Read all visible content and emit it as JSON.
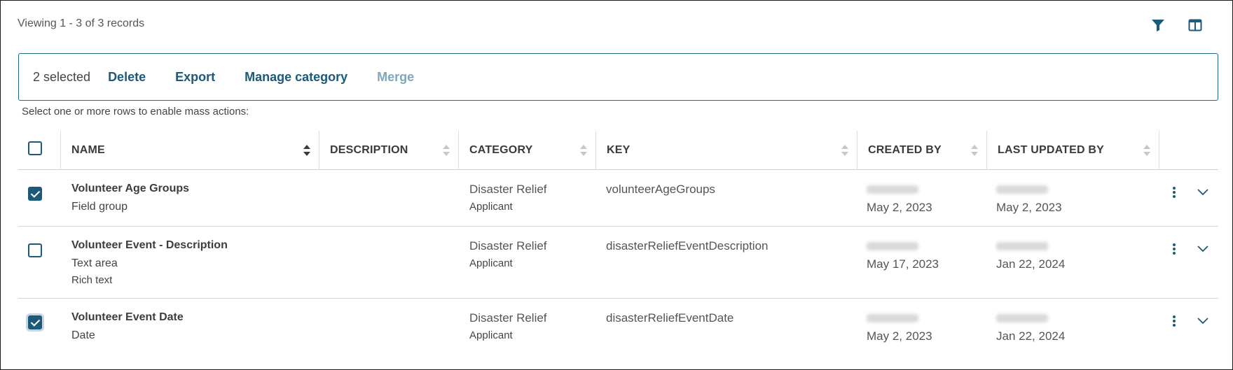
{
  "header": {
    "viewing_text": "Viewing 1 - 3 of 3 records"
  },
  "icons": {
    "filter": "filter-icon",
    "columns": "columns-icon"
  },
  "mass_actions": {
    "selected_text": "2 selected",
    "delete": "Delete",
    "export": "Export",
    "manage_category": "Manage category",
    "merge": "Merge",
    "hint": "Select one or more rows to enable mass actions:"
  },
  "columns": [
    {
      "label": "NAME"
    },
    {
      "label": "DESCRIPTION"
    },
    {
      "label": "CATEGORY"
    },
    {
      "label": "KEY"
    },
    {
      "label": "CREATED BY"
    },
    {
      "label": "LAST UPDATED BY"
    }
  ],
  "rows": [
    {
      "checked": true,
      "name": "Volunteer Age Groups",
      "type": "Field group",
      "subtype": "",
      "category": "Disaster Relief",
      "category_sub": "Applicant",
      "key": "volunteerAgeGroups",
      "created_date": "May 2, 2023",
      "updated_date": "May 2, 2023"
    },
    {
      "checked": false,
      "name": "Volunteer Event - Description",
      "type": "Text area",
      "subtype": "Rich text",
      "category": "Disaster Relief",
      "category_sub": "Applicant",
      "key": "disasterReliefEventDescription",
      "created_date": "May 17, 2023",
      "updated_date": "Jan 22, 2024"
    },
    {
      "checked": true,
      "name": "Volunteer Event Date",
      "type": "Date",
      "subtype": "",
      "category": "Disaster Relief",
      "category_sub": "Applicant",
      "key": "disasterReliefEventDate",
      "created_date": "May 2, 2023",
      "updated_date": "Jan 22, 2024"
    }
  ],
  "colors": {
    "accent": "#1c5a7a",
    "border_accent": "#1b6b8f",
    "disabled_action": "#7fa6bd"
  }
}
